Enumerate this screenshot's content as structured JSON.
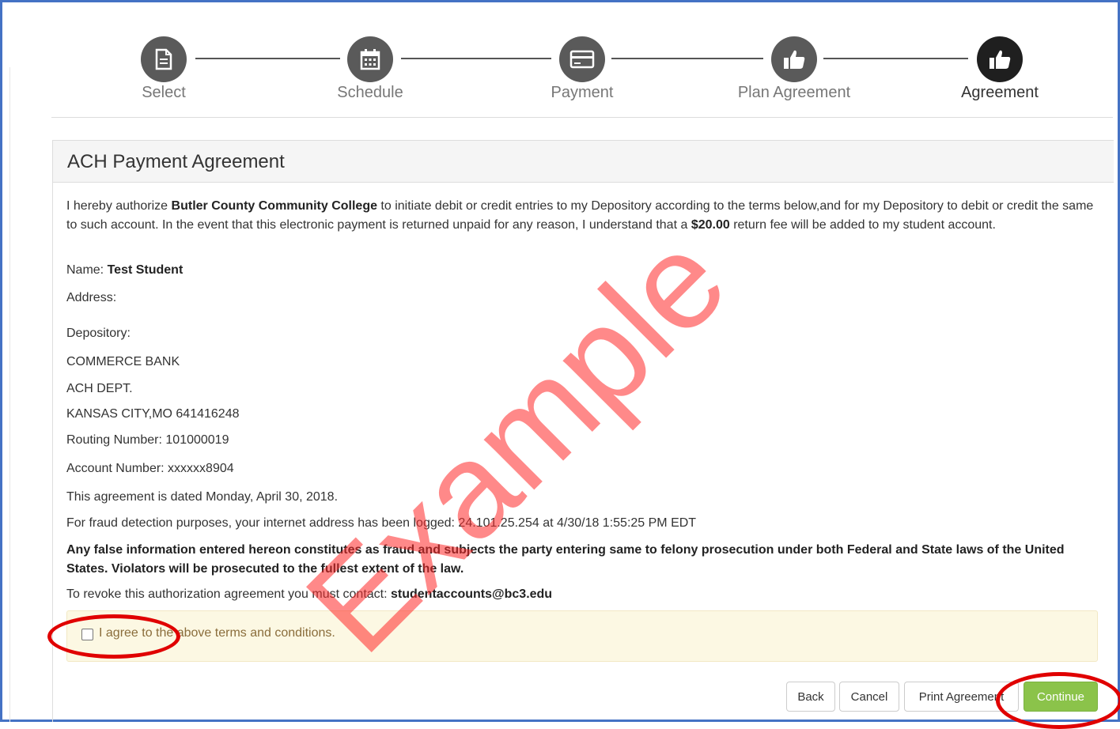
{
  "steps": [
    {
      "label": "Select",
      "icon": "document-icon"
    },
    {
      "label": "Schedule",
      "icon": "calendar-icon"
    },
    {
      "label": "Payment",
      "icon": "credit-card-icon"
    },
    {
      "label": "Plan Agreement",
      "icon": "thumbs-up-icon"
    },
    {
      "label": "Agreement",
      "icon": "thumbs-up-icon"
    }
  ],
  "panel": {
    "title": "ACH Payment Agreement"
  },
  "agreement": {
    "intro_1": "I hereby authorize ",
    "college": "Butler County Community College",
    "intro_2": " to initiate debit or credit entries to my Depository according to the terms below,and for my Depository to debit or credit the same to such account. In the event that this electronic payment is returned unpaid for any reason, I understand that a ",
    "fee": "$20.00",
    "intro_3": " return fee will be added to my student account.",
    "name_label": "Name: ",
    "name_value": "Test Student",
    "address_label": "Address:",
    "depository_label": "Depository:",
    "bank": "COMMERCE BANK",
    "dept": "ACH DEPT.",
    "city": "KANSAS CITY,MO 641416248",
    "routing": "Routing Number: 101000019",
    "account": "Account Number: xxxxxx8904",
    "dated": "This agreement is dated Monday, April 30, 2018.",
    "fraud": "For fraud detection purposes, your internet address has been logged: 24.101.25.254 at 4/30/18 1:55:25 PM EDT",
    "warning": "Any false information entered hereon constitutes as fraud and subjects the party entering same to felony prosecution under both Federal and State laws of the United States. Violators will be prosecuted to the fullest extent of the law.",
    "revoke_label": "To revoke this authorization agreement you must contact: ",
    "revoke_email": "studentaccounts@bc3.edu"
  },
  "agree": {
    "label": "I agree to the above terms and conditions.",
    "checked": false
  },
  "buttons": {
    "back": "Back",
    "cancel": "Cancel",
    "print": "Print Agreement",
    "continue": "Continue"
  },
  "watermark": "Example",
  "colors": {
    "accent_green": "#8bc34a",
    "highlight_red": "#e00000",
    "notice_bg": "#fcf8e3",
    "frame_blue": "#4472c4"
  }
}
